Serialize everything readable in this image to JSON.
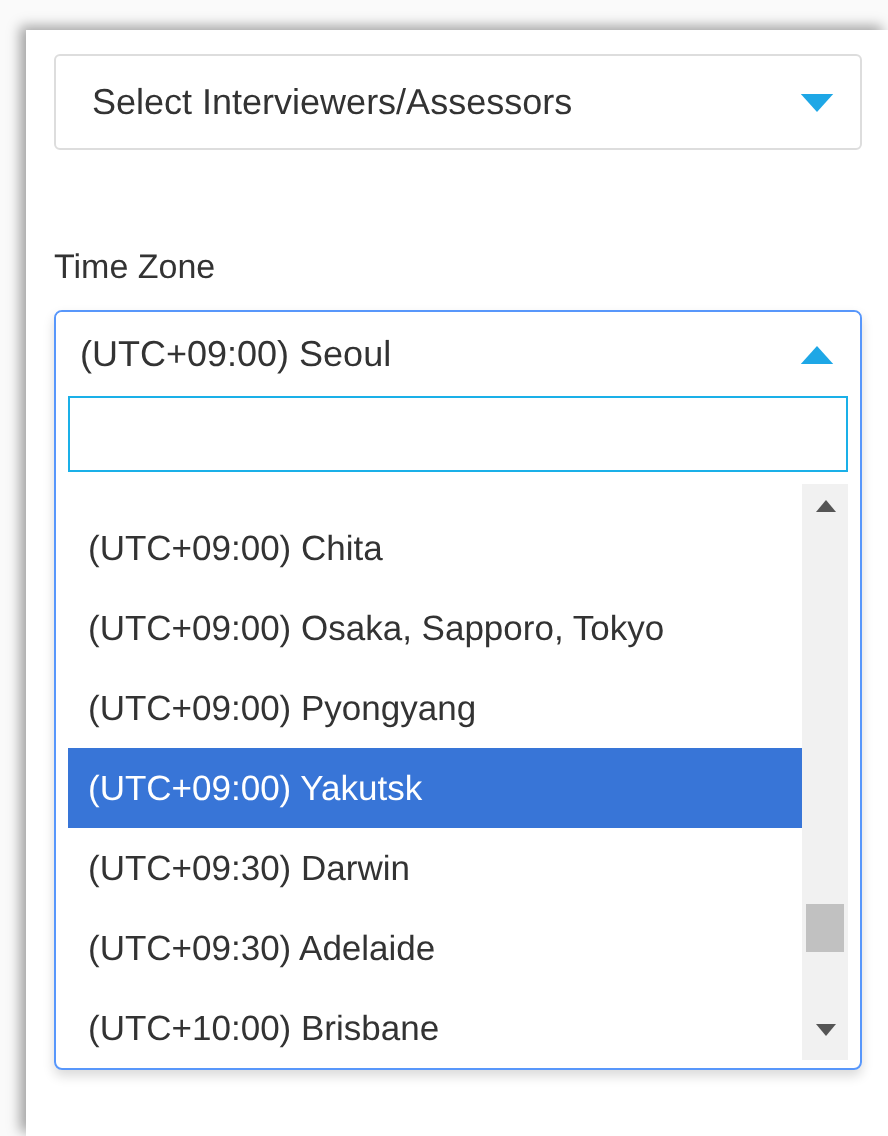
{
  "interviewers_select": {
    "placeholder": "Select Interviewers/Assessors",
    "expanded": false
  },
  "time_zone": {
    "label": "Time Zone",
    "value": "(UTC+09:00) Seoul",
    "expanded": true,
    "options": [
      {
        "label": "(UTC+09:00) Chita",
        "selected": false
      },
      {
        "label": "(UTC+09:00) Osaka, Sapporo, Tokyo",
        "selected": false
      },
      {
        "label": "(UTC+09:00) Pyongyang",
        "selected": false
      },
      {
        "label": "(UTC+09:00) Yakutsk",
        "selected": true
      },
      {
        "label": "(UTC+09:30) Darwin",
        "selected": false
      },
      {
        "label": "(UTC+09:30) Adelaide",
        "selected": false
      },
      {
        "label": "(UTC+10:00) Brisbane",
        "selected": false
      }
    ]
  }
}
